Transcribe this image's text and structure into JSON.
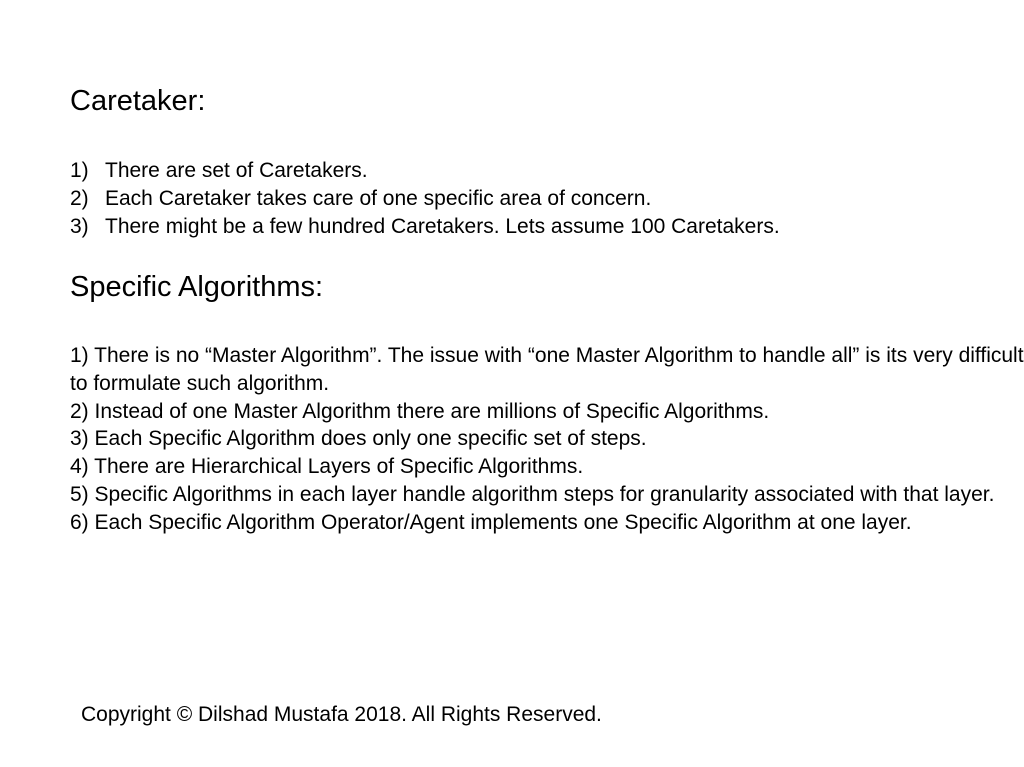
{
  "caretaker": {
    "heading": "Caretaker:",
    "items": [
      {
        "num": "1)",
        "text": "There are set of Caretakers."
      },
      {
        "num": "2)",
        "text": "Each Caretaker takes care of one specific area of concern."
      },
      {
        "num": "3)",
        "text": "There might be a few hundred Caretakers. Lets assume 100 Caretakers."
      }
    ]
  },
  "specific_algorithms": {
    "heading": "Specific Algorithms:",
    "items": [
      "1) There is no “Master Algorithm”. The issue with “one Master Algorithm to handle all” is its very difficult to formulate such algorithm.",
      "2) Instead of one Master Algorithm there are millions of Specific Algorithms.",
      "3) Each Specific Algorithm does only one specific set of steps.",
      "4) There are Hierarchical Layers of Specific Algorithms.",
      "5) Specific Algorithms in each layer handle algorithm steps for granularity associated with that layer.",
      "6) Each Specific Algorithm Operator/Agent implements one Specific Algorithm at one layer."
    ]
  },
  "footer": {
    "copyright": "Copyright © Dilshad Mustafa 2018. All Rights Reserved."
  }
}
